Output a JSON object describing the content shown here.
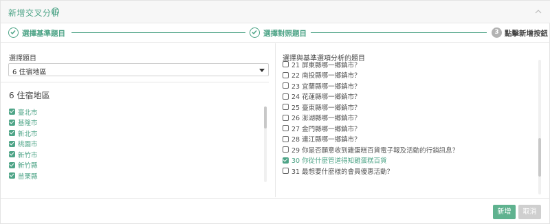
{
  "header": {
    "title": "新增交叉分析",
    "help_glyph": "?"
  },
  "steps": [
    {
      "label": "選擇基準題目",
      "state": "done"
    },
    {
      "label": "選擇對照題目",
      "state": "done"
    },
    {
      "number": "3",
      "label": "點擊新增按鈕",
      "state": "active"
    }
  ],
  "left": {
    "label": "選擇題目",
    "selected": "6 住宿地區",
    "section_title": "6 住宿地區",
    "options": [
      "臺北市",
      "基隆市",
      "新北市",
      "桃園市",
      "新竹市",
      "新竹縣",
      "苗栗縣"
    ]
  },
  "right": {
    "label": "選擇與基準選項分析的題目",
    "items": [
      {
        "text": "21 屏東縣哪一鄉鎮市？",
        "checked": false
      },
      {
        "text": "22 南投縣哪一鄉鎮市？",
        "checked": false
      },
      {
        "text": "23 宜蘭縣哪一鄉鎮市？",
        "checked": false
      },
      {
        "text": "24 花蓮縣哪一鄉鎮市？",
        "checked": false
      },
      {
        "text": "25 臺東縣哪一鄉鎮市？",
        "checked": false
      },
      {
        "text": "26 澎湖縣哪一鄉鎮市？",
        "checked": false
      },
      {
        "text": "27 金門縣哪一鄉鎮市？",
        "checked": false
      },
      {
        "text": "28 連江縣哪一鄉鎮市？",
        "checked": false
      },
      {
        "text": "29 你是否願意收到雞蛋糕百貨電子報及活動的行銷訊息？",
        "checked": false
      },
      {
        "text": "30 你從什麼管道得知雞蛋糕百貨",
        "checked": true
      },
      {
        "text": "31 最想要什麼樣的會員優惠活動？",
        "checked": false
      }
    ]
  },
  "footer": {
    "submit_label": "新增",
    "cancel_label": "取消"
  },
  "colors": {
    "accent": "#4ea487",
    "button": "#5fb28f",
    "disabled": "#cfcfcf"
  }
}
